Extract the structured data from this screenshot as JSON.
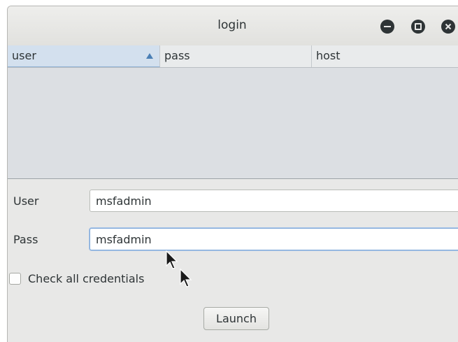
{
  "window": {
    "title": "login"
  },
  "table": {
    "columns": [
      {
        "label": "user",
        "sorted": "ascending"
      },
      {
        "label": "pass"
      },
      {
        "label": "host"
      }
    ],
    "rows": []
  },
  "form": {
    "user_label": "User",
    "user_value": "msfadmin",
    "pass_label": "Pass",
    "pass_value": "msfadmin",
    "check_all_label": "Check all credentials",
    "check_all_checked": false,
    "launch_label": "Launch"
  },
  "icons": {
    "minimize": "minimize-icon",
    "maximize": "maximize-icon",
    "close": "close-icon",
    "sort": "sort-ascending-icon"
  },
  "colors": {
    "sorted_header": "#d3e0ee",
    "focus_border": "#7ea7d8"
  }
}
